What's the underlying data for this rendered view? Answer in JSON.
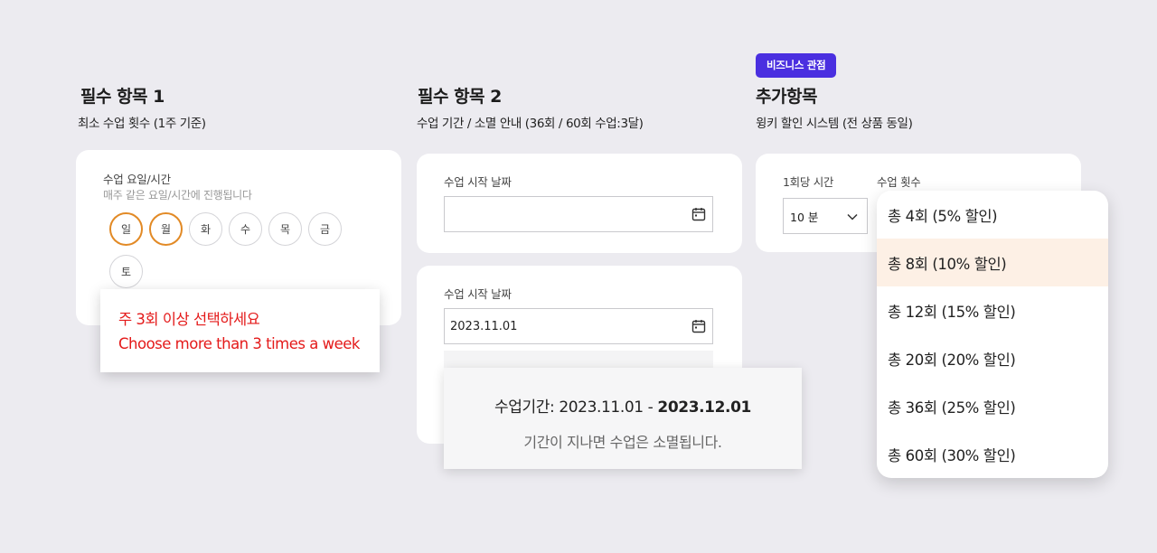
{
  "section1": {
    "title": "필수 항목 1",
    "subtitle": "최소 수업 횟수 (1주 기준)",
    "field_label": "수업 요일/시간",
    "field_hint": "매주 같은 요일/시간에 진행됩니다",
    "days": [
      "일",
      "월",
      "화",
      "수",
      "목",
      "금",
      "토"
    ],
    "selected_days": [
      "일",
      "월"
    ],
    "error_line1": "주 3회 이상 선택하세요",
    "error_line2": "Choose more than 3 times a week"
  },
  "section2": {
    "title": "필수 항목 2",
    "subtitle": "수업 기간 / 소멸 안내  (36회 / 60회 수업:3달)",
    "card1": {
      "label": "수업 시작 날짜",
      "value": ""
    },
    "card2": {
      "label": "수업 시작 날짜",
      "value": "2023.11.01"
    },
    "period_prefix": "수업기간:  2023.11.01 - ",
    "period_end": "2023.12.01",
    "period_note": "기간이 지나면 수업은 소멸됩니다."
  },
  "section3": {
    "badge": "비즈니스 관점",
    "title": "추가항목",
    "subtitle": "윙키 할인 시스템 (전 상품 동일)",
    "duration_label": "1회당 시간",
    "duration_value": "10 분",
    "count_label": "수업 횟수",
    "options": [
      "총 4회 (5% 할인)",
      "총 8회 (10% 할인)",
      "총 12회 (15% 할인)",
      "총 20회 (20% 할인)",
      "총 36회 (25% 할인)",
      "총 60회 (30% 할인)"
    ],
    "highlighted_option": "총 8회 (10% 할인)"
  },
  "colors": {
    "accent_badge": "#4a2fe0",
    "selected_day_ring": "#e28a26",
    "error_text": "#e41a1a",
    "highlight_row": "#fdf0e5"
  }
}
